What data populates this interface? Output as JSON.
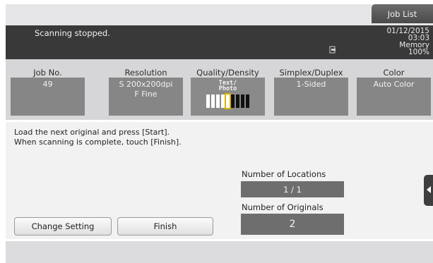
{
  "header": {
    "job_list_label": "Job List"
  },
  "status": {
    "message": "Scanning stopped.",
    "date": "01/12/2015",
    "time": "03:03",
    "memory_label": "Memory",
    "memory_value": "100%"
  },
  "settings": {
    "job_no": {
      "label": "Job No.",
      "value": "49"
    },
    "resolution": {
      "label": "Resolution",
      "line1": "S 200x200dpi",
      "line2": "F Fine"
    },
    "quality_density": {
      "label": "Quality/Density",
      "mode_line1": "Text/",
      "mode_line2": "Photo",
      "density_level": 5,
      "density_steps": 9
    },
    "simplex_duplex": {
      "label": "Simplex/Duplex",
      "value": "1-Sided"
    },
    "color": {
      "label": "Color",
      "value": "Auto Color"
    }
  },
  "message": {
    "line1": "Load the next original and press [Start].",
    "line2": "When scanning is complete, touch [Finish]."
  },
  "counters": {
    "locations_label": "Number of Locations",
    "locations_value": "1  /  1",
    "originals_label": "Number of Originals",
    "originals_value": "2"
  },
  "buttons": {
    "change_setting": "Change Setting",
    "finish": "Finish"
  },
  "colors": {
    "status_bg": "#393939",
    "value_box": "#868686",
    "highlight": "#d9b000"
  }
}
